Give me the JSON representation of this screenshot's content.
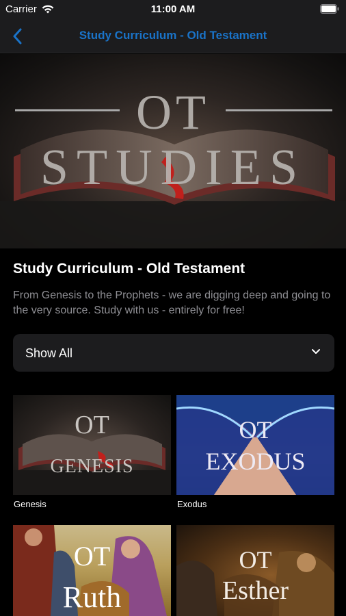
{
  "status_bar": {
    "carrier": "Carrier",
    "time": "11:00 AM"
  },
  "nav": {
    "title": "Study Curriculum - Old Testament",
    "back_icon": "chevron-left-icon"
  },
  "hero": {
    "line1": "OT",
    "line2": "STUDIES"
  },
  "section": {
    "title": "Study Curriculum - Old Testament",
    "description": "From Genesis to the Prophets - we are digging deep and going to the very source. Study with us - entirely for free!"
  },
  "filter": {
    "selected": "Show All",
    "icon": "chevron-down-icon"
  },
  "studies": [
    {
      "label": "Genesis",
      "art_top": "OT",
      "art_bottom": "GENESIS"
    },
    {
      "label": "Exodus",
      "art_top": "OT",
      "art_bottom": "EXODUS"
    },
    {
      "label": "",
      "art_top": "OT",
      "art_bottom": "Ruth"
    },
    {
      "label": "",
      "art_top": "OT",
      "art_bottom": "Esther"
    }
  ],
  "colors": {
    "accent": "#1a73c8",
    "background": "#000000",
    "surface": "#1c1c1e",
    "secondary_text": "#8e8e93"
  }
}
